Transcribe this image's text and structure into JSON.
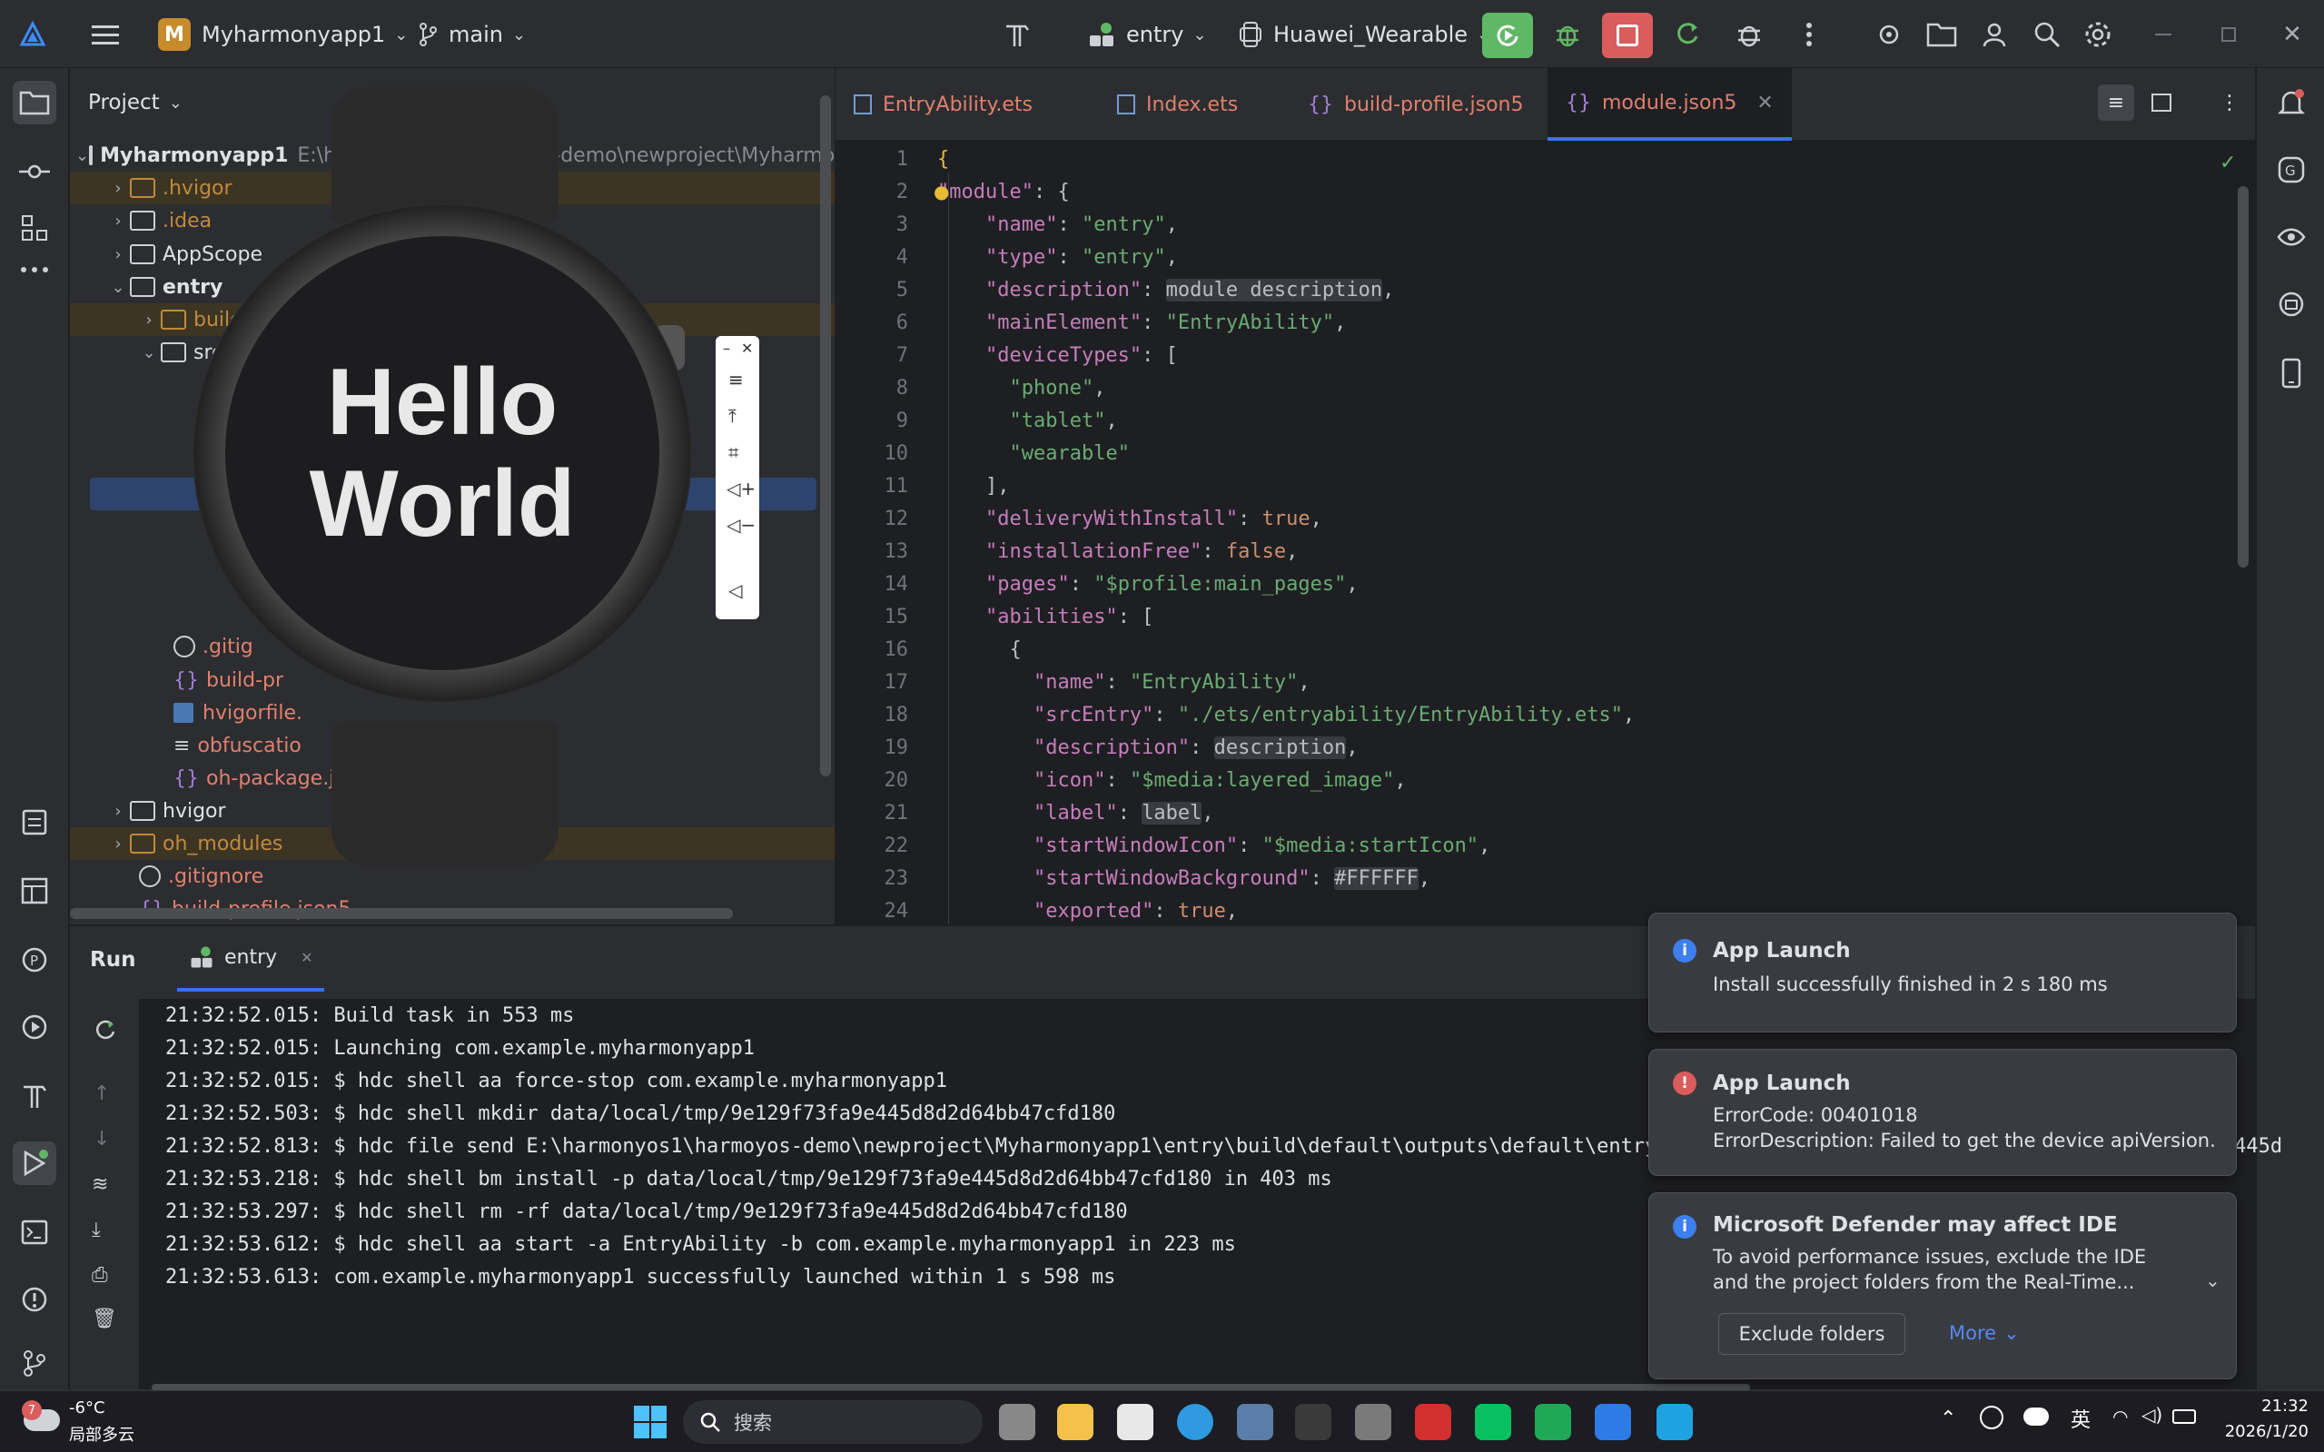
{
  "titlebar": {
    "project_badge": "M",
    "project_name": "Myharmonyapp1",
    "branch": "main",
    "run_config": "entry",
    "device": "Huawei_Wearable"
  },
  "left_strip": {
    "icons": [
      "folder-icon",
      "commit-icon",
      "structure-icon",
      "more-icon",
      "todo-icon",
      "layout-icon",
      "profiler-icon",
      "run-anything-icon",
      "build-icon",
      "run-icon",
      "terminal-icon",
      "problems-icon",
      "git-icon"
    ]
  },
  "project_panel": {
    "title": "Project",
    "root": "Myharmonyapp1",
    "root_path": "E:\\harmonyos1\\harmoyos-demo\\newproject\\Myharmonyapp1",
    "items": [
      ".hvigor",
      ".idea",
      "AppScope",
      "entry",
      "build",
      "src",
      "hvigor",
      "oh_modules",
      ".gitignore",
      "build-profile.json5",
      ".gitig",
      "build-pr",
      "hvigorfile.",
      "obfuscatio",
      "oh-package.j"
    ]
  },
  "emulator": {
    "line1": "Hello",
    "line2": "World"
  },
  "editor": {
    "tabs": [
      "EntryAbility.ets",
      "Index.ets",
      "build-profile.json5",
      "module.json5"
    ],
    "active_tab": "module.json5",
    "lines": [
      {
        "n": "1",
        "segs": [
          [
            "y",
            "{"
          ]
        ]
      },
      {
        "n": "2",
        "segs": [
          [
            "k",
            "\"module\""
          ],
          [
            "p",
            ": {"
          ]
        ]
      },
      {
        "n": "3",
        "segs": [
          [
            "p",
            "    "
          ],
          [
            "k",
            "\"name\""
          ],
          [
            "p",
            ": "
          ],
          [
            "s",
            "\"entry\""
          ],
          [
            "p",
            ","
          ]
        ]
      },
      {
        "n": "4",
        "segs": [
          [
            "p",
            "    "
          ],
          [
            "k",
            "\"type\""
          ],
          [
            "p",
            ": "
          ],
          [
            "s",
            "\"entry\""
          ],
          [
            "p",
            ","
          ]
        ]
      },
      {
        "n": "5",
        "segs": [
          [
            "p",
            "    "
          ],
          [
            "k",
            "\"description\""
          ],
          [
            "p",
            ": "
          ],
          [
            "hl",
            "module description"
          ],
          [
            "p",
            ","
          ]
        ]
      },
      {
        "n": "6",
        "segs": [
          [
            "p",
            "    "
          ],
          [
            "k",
            "\"mainElement\""
          ],
          [
            "p",
            ": "
          ],
          [
            "s",
            "\"EntryAbility\""
          ],
          [
            "p",
            ","
          ]
        ]
      },
      {
        "n": "7",
        "segs": [
          [
            "p",
            "    "
          ],
          [
            "k",
            "\"deviceTypes\""
          ],
          [
            "p",
            ": ["
          ]
        ]
      },
      {
        "n": "8",
        "segs": [
          [
            "p",
            "      "
          ],
          [
            "s",
            "\"phone\""
          ],
          [
            "p",
            ","
          ]
        ]
      },
      {
        "n": "9",
        "segs": [
          [
            "p",
            "      "
          ],
          [
            "s",
            "\"tablet\""
          ],
          [
            "p",
            ","
          ]
        ]
      },
      {
        "n": "10",
        "segs": [
          [
            "p",
            "      "
          ],
          [
            "s",
            "\"wearable\""
          ]
        ]
      },
      {
        "n": "11",
        "segs": [
          [
            "p",
            "    ],"
          ]
        ]
      },
      {
        "n": "12",
        "segs": [
          [
            "p",
            "    "
          ],
          [
            "k",
            "\"deliveryWithInstall\""
          ],
          [
            "p",
            ": "
          ],
          [
            "n",
            "true"
          ],
          [
            "p",
            ","
          ]
        ]
      },
      {
        "n": "13",
        "segs": [
          [
            "p",
            "    "
          ],
          [
            "k",
            "\"installationFree\""
          ],
          [
            "p",
            ": "
          ],
          [
            "n",
            "false"
          ],
          [
            "p",
            ","
          ]
        ]
      },
      {
        "n": "14",
        "segs": [
          [
            "p",
            "    "
          ],
          [
            "k",
            "\"pages\""
          ],
          [
            "p",
            ": "
          ],
          [
            "s",
            "\"$profile:main_pages\""
          ],
          [
            "p",
            ","
          ]
        ]
      },
      {
        "n": "15",
        "segs": [
          [
            "p",
            "    "
          ],
          [
            "k",
            "\"abilities\""
          ],
          [
            "p",
            ": ["
          ]
        ]
      },
      {
        "n": "16",
        "segs": [
          [
            "p",
            "      {"
          ]
        ]
      },
      {
        "n": "17",
        "segs": [
          [
            "p",
            "        "
          ],
          [
            "k",
            "\"name\""
          ],
          [
            "p",
            ": "
          ],
          [
            "s",
            "\"EntryAbility\""
          ],
          [
            "p",
            ","
          ]
        ]
      },
      {
        "n": "18",
        "segs": [
          [
            "p",
            "        "
          ],
          [
            "k",
            "\"srcEntry\""
          ],
          [
            "p",
            ": "
          ],
          [
            "s",
            "\"./ets/entryability/EntryAbility.ets\""
          ],
          [
            "p",
            ","
          ]
        ]
      },
      {
        "n": "19",
        "segs": [
          [
            "p",
            "        "
          ],
          [
            "k",
            "\"description\""
          ],
          [
            "p",
            ": "
          ],
          [
            "hl",
            "description"
          ],
          [
            "p",
            ","
          ]
        ]
      },
      {
        "n": "20",
        "segs": [
          [
            "p",
            "        "
          ],
          [
            "k",
            "\"icon\""
          ],
          [
            "p",
            ": "
          ],
          [
            "s",
            "\"$media:layered_image\""
          ],
          [
            "p",
            ","
          ]
        ]
      },
      {
        "n": "21",
        "segs": [
          [
            "p",
            "        "
          ],
          [
            "k",
            "\"label\""
          ],
          [
            "p",
            ": "
          ],
          [
            "hl",
            "label"
          ],
          [
            "p",
            ","
          ]
        ]
      },
      {
        "n": "22",
        "segs": [
          [
            "p",
            "        "
          ],
          [
            "k",
            "\"startWindowIcon\""
          ],
          [
            "p",
            ": "
          ],
          [
            "s",
            "\"$media:startIcon\""
          ],
          [
            "p",
            ","
          ]
        ]
      },
      {
        "n": "23",
        "segs": [
          [
            "p",
            "        "
          ],
          [
            "k",
            "\"startWindowBackground\""
          ],
          [
            "p",
            ": "
          ],
          [
            "hl",
            "#FFFFFF"
          ],
          [
            "p",
            ","
          ]
        ]
      },
      {
        "n": "24",
        "segs": [
          [
            "p",
            "        "
          ],
          [
            "k",
            "\"exported\""
          ],
          [
            "p",
            ": "
          ],
          [
            "n",
            "true"
          ],
          [
            "p",
            ","
          ]
        ]
      }
    ]
  },
  "run_panel": {
    "title": "Run",
    "tab": "entry",
    "logs": [
      "21:32:52.015: Build task in 553 ms",
      "21:32:52.015: Launching com.example.myharmonyapp1",
      "21:32:52.015: $ hdc shell aa force-stop com.example.myharmonyapp1",
      "21:32:52.503: $ hdc shell mkdir data/local/tmp/9e129f73fa9e445d8d2d64bb47cfd180",
      "21:32:52.813: $ hdc file send E:\\harmonyos1\\harmoyos-demo\\newproject\\Myharmonyapp1\\entry\\build\\default\\outputs\\default\\entry-default-signed.hap \"data/local/tmp/9e129f73fa9e445d",
      "21:32:53.218: $ hdc shell bm install -p data/local/tmp/9e129f73fa9e445d8d2d64bb47cfd180 in 403 ms",
      "21:32:53.297: $ hdc shell rm -rf data/local/tmp/9e129f73fa9e445d8d2d64bb47cfd180",
      "21:32:53.612: $ hdc shell aa start -a EntryAbility -b com.example.myharmonyapp1 in 223 ms",
      "21:32:53.613: com.example.myharmonyapp1 successfully launched within 1 s 598 ms"
    ]
  },
  "notifications": [
    {
      "title": "App Launch",
      "body": [
        "Install successfully finished in 2 s 180 ms"
      ],
      "kind": "info"
    },
    {
      "title": "App Launch",
      "body": [
        "ErrorCode: 00401018",
        "ErrorDescription: Failed to get the device apiVersion."
      ],
      "kind": "error"
    },
    {
      "title": "Microsoft Defender may affect IDE",
      "body": [
        "To avoid performance issues, exclude the IDE",
        "and the project folders from the Real-Time..."
      ],
      "kind": "info",
      "button": "Exclude folders",
      "more": "More"
    }
  ],
  "taskbar": {
    "weather_temp": "-6°C",
    "weather_desc": "局部多云",
    "weather_badge": "7",
    "search": "搜索",
    "ime": "英",
    "time": "21:32",
    "date": "2026/1/20"
  },
  "colors": {
    "accent": "#3574f0",
    "run_green": "#5fb865",
    "stop_red": "#db5c5c"
  }
}
